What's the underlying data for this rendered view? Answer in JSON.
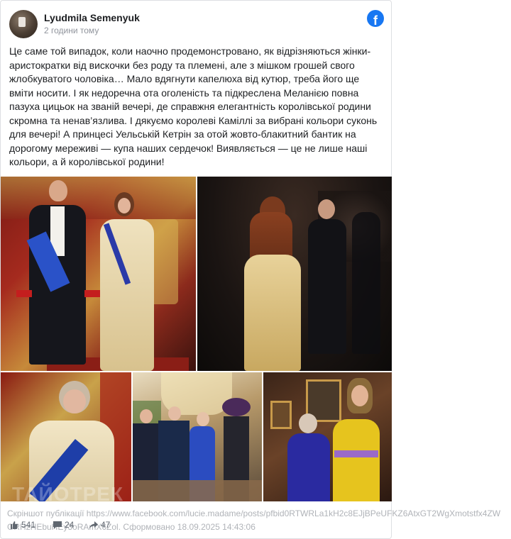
{
  "post": {
    "author": "Lyudmila Semenyuk",
    "time": "2 години тому",
    "platform_icon": "facebook-icon",
    "text": "Це саме той випадок, коли наочно продемонстровано, як відрізняються жінки-аристократки від вискочки без роду та племені, але з мішком грошей свого жлобкуватого чоловіка… Мало вдягнути капелюха від кутюр, треба його ще вміти носити. І як недоречна ота оголеність та підкреслена Меланією повна пазуха цицьок на званій вечері, де справжня елегантність королівської родини скромна та ненав’язлива. І дякуємо королеві Каміллі за вибрані кольори суконь для вечері! А принцесі Уельській Кетрін за отой жовто-блакитний бантик на дорогому мереживі — купа наших сердечок! Виявляється — це не лише наші кольори, а й королівської родини!"
  },
  "photos": [
    {
      "name": "photo-royal-couple"
    },
    {
      "name": "photo-gown-back"
    },
    {
      "name": "photo-princess-anne"
    },
    {
      "name": "photo-group-table"
    },
    {
      "name": "photo-melania-queen"
    }
  ],
  "watermark": "ТАЙОТРЕК",
  "footer": {
    "caption_prefix": "Скріншот публікації",
    "url": "https://www.facebook.com/lucie.madame/posts/pfbid0RTWRLa1kH2c8EJjBPeUFKZ6AtxGT2WgXmotstfx4ZWGRHzHEbuHEy3oRAmX6Zol.",
    "generated": "Сформовано 18.09.2025 14:43:06"
  },
  "stats": {
    "likes": "541",
    "comments": "24",
    "shares": "47"
  },
  "colors": {
    "brand": "#1877f2",
    "muted": "#90949c",
    "border": "#dddfe2"
  }
}
